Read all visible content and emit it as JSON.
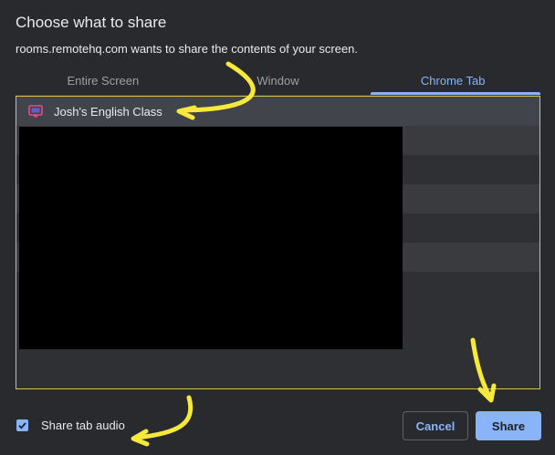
{
  "dialog": {
    "title": "Choose what to share",
    "subtitle": "rooms.remotehq.com wants to share the contents of your screen."
  },
  "tabs": [
    {
      "label": "Entire Screen",
      "active": false
    },
    {
      "label": "Window",
      "active": false
    },
    {
      "label": "Chrome Tab",
      "active": true
    }
  ],
  "list": {
    "selected_item": {
      "title": "Josh's English Class",
      "icon": "screen-share-icon"
    }
  },
  "footer": {
    "checkbox_label": "Share tab audio",
    "checkbox_checked": true,
    "cancel_label": "Cancel",
    "share_label": "Share"
  },
  "colors": {
    "accent": "#8ab4f8",
    "highlight_border": "#d8c24e",
    "annotation_arrow": "#f7e93b",
    "background": "#292a2d"
  }
}
